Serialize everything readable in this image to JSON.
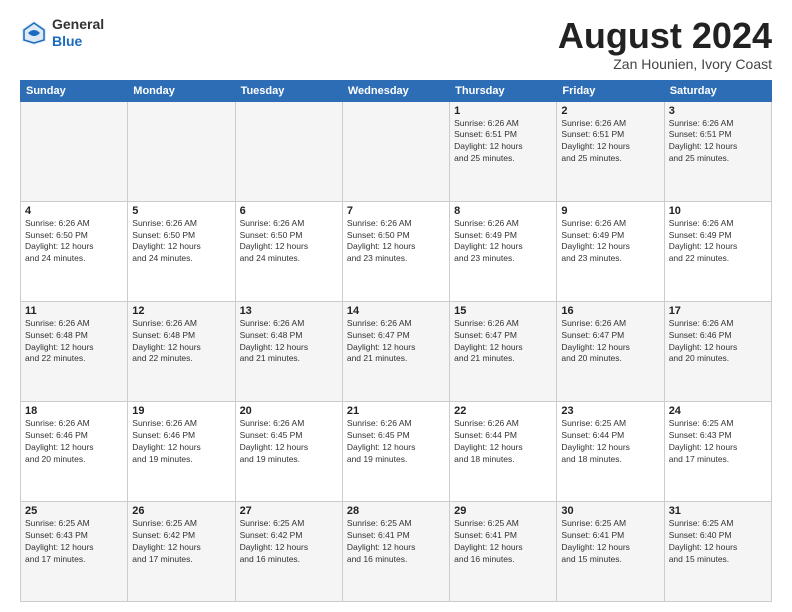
{
  "header": {
    "logo_line1": "General",
    "logo_line2": "Blue",
    "title": "August 2024",
    "location": "Zan Hounien, Ivory Coast"
  },
  "days_of_week": [
    "Sunday",
    "Monday",
    "Tuesday",
    "Wednesday",
    "Thursday",
    "Friday",
    "Saturday"
  ],
  "weeks": [
    [
      {
        "day": "",
        "info": ""
      },
      {
        "day": "",
        "info": ""
      },
      {
        "day": "",
        "info": ""
      },
      {
        "day": "",
        "info": ""
      },
      {
        "day": "1",
        "info": "Sunrise: 6:26 AM\nSunset: 6:51 PM\nDaylight: 12 hours\nand 25 minutes."
      },
      {
        "day": "2",
        "info": "Sunrise: 6:26 AM\nSunset: 6:51 PM\nDaylight: 12 hours\nand 25 minutes."
      },
      {
        "day": "3",
        "info": "Sunrise: 6:26 AM\nSunset: 6:51 PM\nDaylight: 12 hours\nand 25 minutes."
      }
    ],
    [
      {
        "day": "4",
        "info": "Sunrise: 6:26 AM\nSunset: 6:50 PM\nDaylight: 12 hours\nand 24 minutes."
      },
      {
        "day": "5",
        "info": "Sunrise: 6:26 AM\nSunset: 6:50 PM\nDaylight: 12 hours\nand 24 minutes."
      },
      {
        "day": "6",
        "info": "Sunrise: 6:26 AM\nSunset: 6:50 PM\nDaylight: 12 hours\nand 24 minutes."
      },
      {
        "day": "7",
        "info": "Sunrise: 6:26 AM\nSunset: 6:50 PM\nDaylight: 12 hours\nand 23 minutes."
      },
      {
        "day": "8",
        "info": "Sunrise: 6:26 AM\nSunset: 6:49 PM\nDaylight: 12 hours\nand 23 minutes."
      },
      {
        "day": "9",
        "info": "Sunrise: 6:26 AM\nSunset: 6:49 PM\nDaylight: 12 hours\nand 23 minutes."
      },
      {
        "day": "10",
        "info": "Sunrise: 6:26 AM\nSunset: 6:49 PM\nDaylight: 12 hours\nand 22 minutes."
      }
    ],
    [
      {
        "day": "11",
        "info": "Sunrise: 6:26 AM\nSunset: 6:48 PM\nDaylight: 12 hours\nand 22 minutes."
      },
      {
        "day": "12",
        "info": "Sunrise: 6:26 AM\nSunset: 6:48 PM\nDaylight: 12 hours\nand 22 minutes."
      },
      {
        "day": "13",
        "info": "Sunrise: 6:26 AM\nSunset: 6:48 PM\nDaylight: 12 hours\nand 21 minutes."
      },
      {
        "day": "14",
        "info": "Sunrise: 6:26 AM\nSunset: 6:47 PM\nDaylight: 12 hours\nand 21 minutes."
      },
      {
        "day": "15",
        "info": "Sunrise: 6:26 AM\nSunset: 6:47 PM\nDaylight: 12 hours\nand 21 minutes."
      },
      {
        "day": "16",
        "info": "Sunrise: 6:26 AM\nSunset: 6:47 PM\nDaylight: 12 hours\nand 20 minutes."
      },
      {
        "day": "17",
        "info": "Sunrise: 6:26 AM\nSunset: 6:46 PM\nDaylight: 12 hours\nand 20 minutes."
      }
    ],
    [
      {
        "day": "18",
        "info": "Sunrise: 6:26 AM\nSunset: 6:46 PM\nDaylight: 12 hours\nand 20 minutes."
      },
      {
        "day": "19",
        "info": "Sunrise: 6:26 AM\nSunset: 6:46 PM\nDaylight: 12 hours\nand 19 minutes."
      },
      {
        "day": "20",
        "info": "Sunrise: 6:26 AM\nSunset: 6:45 PM\nDaylight: 12 hours\nand 19 minutes."
      },
      {
        "day": "21",
        "info": "Sunrise: 6:26 AM\nSunset: 6:45 PM\nDaylight: 12 hours\nand 19 minutes."
      },
      {
        "day": "22",
        "info": "Sunrise: 6:26 AM\nSunset: 6:44 PM\nDaylight: 12 hours\nand 18 minutes."
      },
      {
        "day": "23",
        "info": "Sunrise: 6:25 AM\nSunset: 6:44 PM\nDaylight: 12 hours\nand 18 minutes."
      },
      {
        "day": "24",
        "info": "Sunrise: 6:25 AM\nSunset: 6:43 PM\nDaylight: 12 hours\nand 17 minutes."
      }
    ],
    [
      {
        "day": "25",
        "info": "Sunrise: 6:25 AM\nSunset: 6:43 PM\nDaylight: 12 hours\nand 17 minutes."
      },
      {
        "day": "26",
        "info": "Sunrise: 6:25 AM\nSunset: 6:42 PM\nDaylight: 12 hours\nand 17 minutes."
      },
      {
        "day": "27",
        "info": "Sunrise: 6:25 AM\nSunset: 6:42 PM\nDaylight: 12 hours\nand 16 minutes."
      },
      {
        "day": "28",
        "info": "Sunrise: 6:25 AM\nSunset: 6:41 PM\nDaylight: 12 hours\nand 16 minutes."
      },
      {
        "day": "29",
        "info": "Sunrise: 6:25 AM\nSunset: 6:41 PM\nDaylight: 12 hours\nand 16 minutes."
      },
      {
        "day": "30",
        "info": "Sunrise: 6:25 AM\nSunset: 6:41 PM\nDaylight: 12 hours\nand 15 minutes."
      },
      {
        "day": "31",
        "info": "Sunrise: 6:25 AM\nSunset: 6:40 PM\nDaylight: 12 hours\nand 15 minutes."
      }
    ]
  ]
}
